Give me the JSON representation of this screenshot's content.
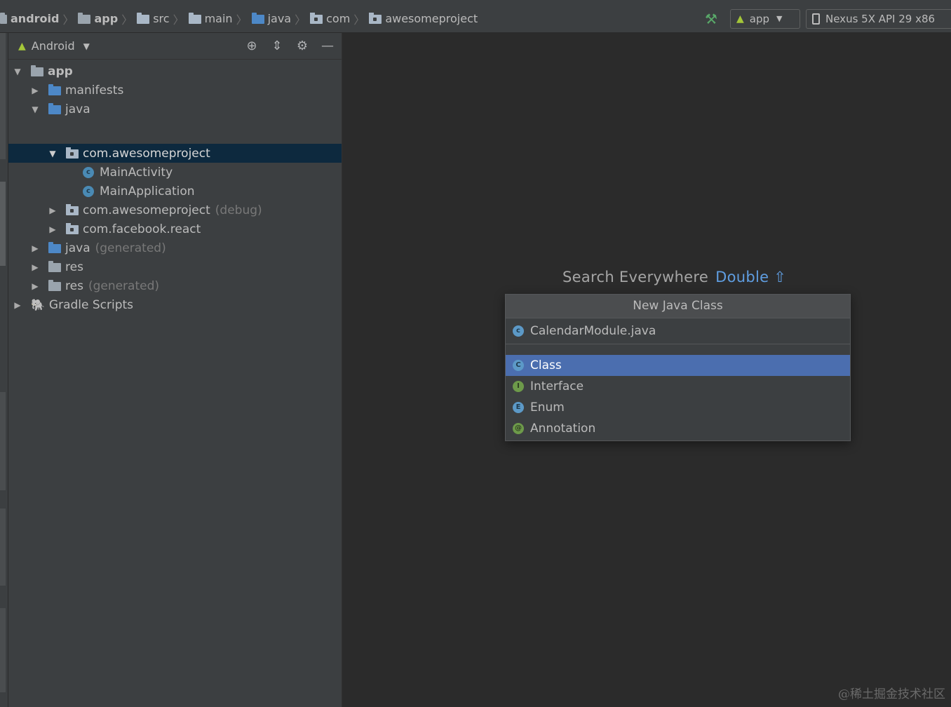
{
  "breadcrumbs": [
    {
      "label": "android",
      "icon": "folder-icon"
    },
    {
      "label": "app",
      "icon": "module-folder-icon"
    },
    {
      "label": "src",
      "icon": "folder-icon"
    },
    {
      "label": "main",
      "icon": "folder-icon"
    },
    {
      "label": "java",
      "icon": "source-folder-icon"
    },
    {
      "label": "com",
      "icon": "package-icon"
    },
    {
      "label": "awesomeproject",
      "icon": "package-icon"
    }
  ],
  "toolbar": {
    "run_config": "app",
    "device": "Nexus 5X API 29 x86"
  },
  "panel": {
    "view_mode": "Android"
  },
  "tree": [
    {
      "label": "app",
      "dim": "",
      "state": "expanded",
      "icon": "module-icon"
    },
    {
      "label": "manifests",
      "dim": "",
      "state": "collapsed",
      "icon": "folder-icon"
    },
    {
      "label": "java",
      "dim": "",
      "state": "expanded",
      "icon": "source-folder-icon"
    },
    {
      "label": "com.awesomeproject",
      "dim": "",
      "state": "expanded",
      "icon": "package-icon"
    },
    {
      "label": "MainActivity",
      "dim": "",
      "state": "leaf",
      "icon": "java-class-icon"
    },
    {
      "label": "MainApplication",
      "dim": "",
      "state": "leaf",
      "icon": "java-class-icon"
    },
    {
      "label": "com.awesomeproject",
      "dim": "(debug)",
      "state": "collapsed",
      "icon": "package-icon"
    },
    {
      "label": "com.facebook.react",
      "dim": "",
      "state": "collapsed",
      "icon": "package-icon"
    },
    {
      "label": "java",
      "dim": "(generated)",
      "state": "collapsed",
      "icon": "generated-source-icon"
    },
    {
      "label": "res",
      "dim": "",
      "state": "collapsed",
      "icon": "resource-folder-icon"
    },
    {
      "label": "res",
      "dim": "(generated)",
      "state": "collapsed",
      "icon": "resource-folder-icon"
    },
    {
      "label": "Gradle Scripts",
      "dim": "",
      "state": "collapsed",
      "icon": "gradle-icon"
    }
  ],
  "hint": {
    "text": "Search Everywhere",
    "shortcut": "Double ⇧"
  },
  "dialog": {
    "title": "New Java Class",
    "input_value": "CalendarModule.java",
    "options": [
      {
        "label": "Class",
        "badge": "C"
      },
      {
        "label": "Interface",
        "badge": "I"
      },
      {
        "label": "Enum",
        "badge": "E"
      },
      {
        "label": "Annotation",
        "badge": "@"
      }
    ],
    "selected_index": 0
  },
  "watermark": "@稀土掘金技术社区",
  "colors": {
    "selection": "#4b6eaf",
    "tree_selection": "#0d293e",
    "accent_link": "#5f9de0",
    "android_green": "#a4c639"
  }
}
